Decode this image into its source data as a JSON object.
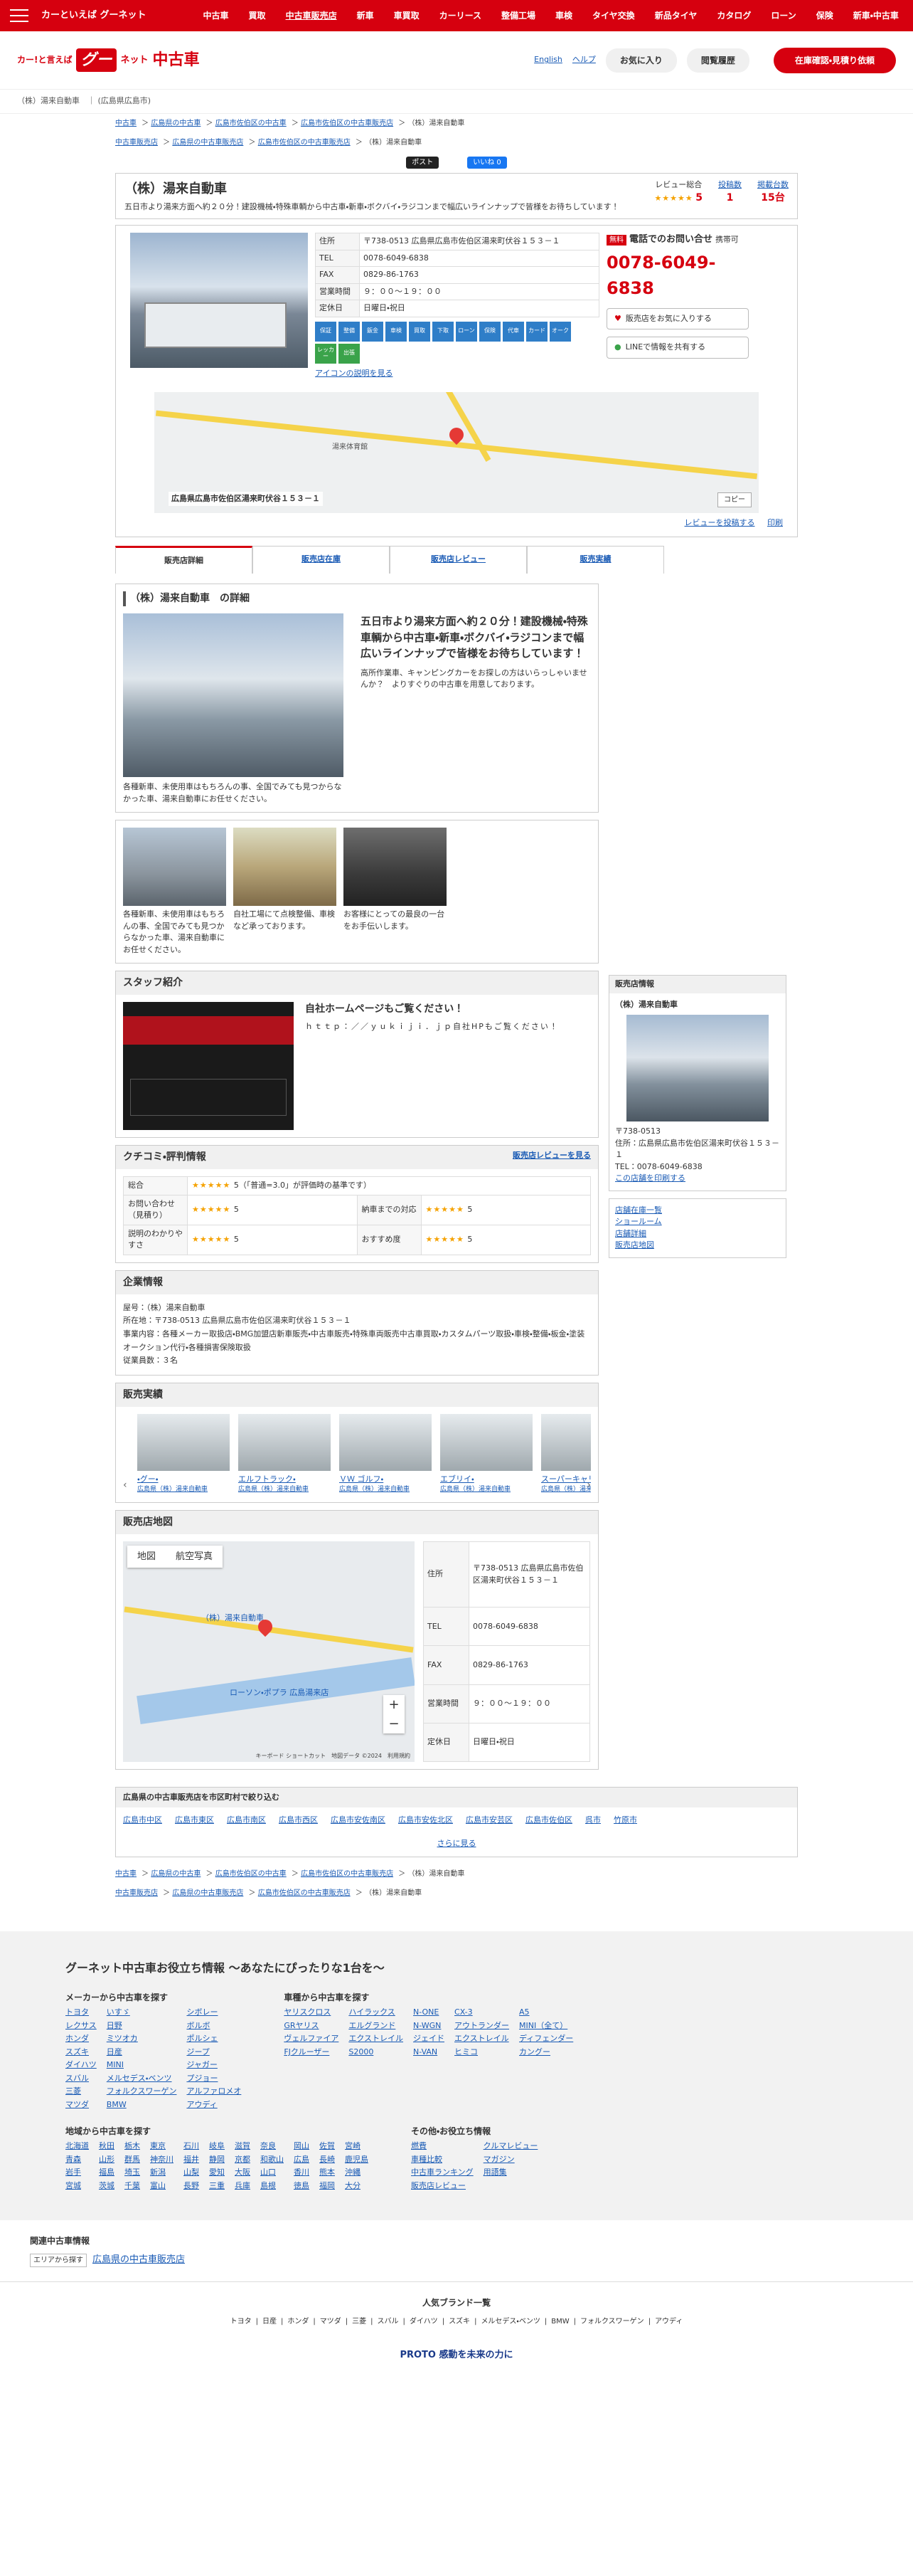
{
  "topbar": {
    "logo": "カーといえば グーネット",
    "nav": [
      "中古車",
      "買取",
      "中古車販売店",
      "新車",
      "車買取",
      "カーリース",
      "整備工場",
      "車検",
      "タイヤ交換",
      "新品タイヤ",
      "カタログ",
      "ローン",
      "保険",
      "新車・中古車"
    ]
  },
  "header": {
    "slogan": "カー!と言えば",
    "goo": "グー",
    "net": "ネット",
    "usedcar": "中古車",
    "english": "English",
    "help": "ヘルプ",
    "fav": "お気に入り",
    "history": "閲覧履歴",
    "cta": "在庫確認・見積り依頼"
  },
  "shopline": "（株）湯来自動車　｜ (広島県広島市)",
  "breadcrumb1": [
    "中古車",
    "広島県の中古車",
    "広島市佐伯区の中古車",
    "広島市佐伯区の中古車販売店",
    "（株）湯来自動車"
  ],
  "breadcrumb2": [
    "中古車販売店",
    "広島県の中古車販売店",
    "広島市佐伯区の中古車販売店",
    "（株）湯来自動車"
  ],
  "share": {
    "x": "ポスト",
    "fb": "いいね 0"
  },
  "shop": {
    "name": "（株）湯来自動車",
    "lead": "五日市より湯来方面へ約２０分！建設機械・特殊車輌から中古車・新車・ボクバイ・ラジコンまで幅広いラインナップで皆様をお待ちしています！",
    "review_label": "レビュー総合",
    "review_score": "5",
    "review_count_label": "投稿数",
    "review_count": "1",
    "stock_label": "掲載台数",
    "stock_count": "15台"
  },
  "info": [
    {
      "k": "住所",
      "v": "〒738-0513 広島県広島市佐伯区湯来町伏谷１５３－１"
    },
    {
      "k": "TEL",
      "v": "0078-6049-6838"
    },
    {
      "k": "FAX",
      "v": "0829-86-1763"
    },
    {
      "k": "営業時間",
      "v": "９：００～１９：００"
    },
    {
      "k": "定休日",
      "v": "日曜日・祝日"
    }
  ],
  "icons": [
    "保証",
    "整備",
    "鈑金",
    "車検",
    "買取",
    "下取",
    "ローン",
    "保険",
    "代車",
    "カード",
    "オーク",
    "レッカー",
    "出張"
  ],
  "icon_link": "アイコンの説明を見る",
  "call": {
    "tag": "無料",
    "label": "電話でのお問い合せ",
    "sub": "携帯可",
    "tel": "0078-6049-6838",
    "fav_btn": "販売店をお気に入りする",
    "line_btn": "LINEで情報を共有する"
  },
  "map_small": {
    "addr": "広島県広島市佐伯区湯来町伏谷１５３－１",
    "copy": "コピー",
    "place": "湯来体育館"
  },
  "map_links": {
    "review": "レビューを投稿する",
    "print": "印刷"
  },
  "tabs": [
    "販売店詳細",
    "販売店在庫",
    "販売店レビュー",
    "販売実績"
  ],
  "detail": {
    "heading": "（株）湯来自動車　の詳細",
    "title": "五日市より湯来方面へ約２０分！建設機械・特殊車輌から中古車・新車・ボクバイ・ラジコンまで幅広いラインナップで皆様をお待ちしています！",
    "text": "高所作業車、キャンピングカーをお探しの方はいらっしゃいませんか？　よりすぐりの中古車を用意しております。",
    "caption": "各種新車、未使用車はもちろんの事、全国でみても見つからなかった車、湯来自動車にお任せください。"
  },
  "gallery": [
    {
      "t": "各種新車、未使用車はもちろんの事、全国でみても見つからなかった車、湯来自動車にお任せください。"
    },
    {
      "t": "自社工場にて点検整備、車検など承っております。"
    },
    {
      "t": "お客様にとっての最良の一台をお手伝いします。"
    }
  ],
  "staff": {
    "heading": "スタッフ紹介",
    "title": "自社ホームページもご覧ください！",
    "url": "ｈｔｔｐ：／／ｙｕｋｉｊｉ．ｊｐ自社HPもご覧ください！"
  },
  "reviews": {
    "heading": "クチコミ・評判情報",
    "link": "販売店レビューを見る",
    "total_label": "総合",
    "total": "5（「普通=3.0」が評価時の基準です）",
    "rows": [
      [
        "お問い合わせ（見積り）",
        "5",
        "納車までの対応",
        "5"
      ],
      [
        "説明のわかりやすさ",
        "5",
        "おすすめ度",
        "5"
      ]
    ]
  },
  "corp": {
    "heading": "企業情報",
    "lines": [
      "屋号：（株）湯来自動車",
      "所在地：〒738-0513 広島県広島市佐伯区湯来町伏谷１５３－１",
      "事業内容：各種メーカー取扱店・BMG加盟店新車販売・中古車販売・特殊車両販売中古車買取・カスタムパーツ取扱・車検・整備・板金・塗装オークション代行・各種損害保険取扱",
      "従業員数：３名"
    ]
  },
  "sales": {
    "heading": "販売実績",
    "cars": [
      {
        "n": "・グー・",
        "s": "広島県（株）湯来自動車"
      },
      {
        "n": "エルフトラック・",
        "s": "広島県（株）湯来自動車"
      },
      {
        "n": "ＶＷ ゴルフ・",
        "s": "広島県（株）湯来自動車"
      },
      {
        "n": "エブリイ・",
        "s": "広島県（株）湯来自動車"
      },
      {
        "n": "スーパーキャリイ・",
        "s": "広島県（株）湯来自動車"
      }
    ]
  },
  "mapsect": {
    "heading": "販売店地図",
    "map": "地図",
    "sat": "航空写真",
    "pinlabel": "（株）湯来自動車",
    "place2": "ローソン・ポプラ 広島湯来店",
    "foot": "キーボード ショートカット　地図データ ©2024　利用規約",
    "info": [
      {
        "k": "住所",
        "v": "〒738-0513 広島県広島市佐伯区湯来町伏谷１５３－１"
      },
      {
        "k": "TEL",
        "v": "0078-6049-6838"
      },
      {
        "k": "FAX",
        "v": "0829-86-1763"
      },
      {
        "k": "営業時間",
        "v": "９：００～１９：００"
      },
      {
        "k": "定休日",
        "v": "日曜日・祝日"
      }
    ]
  },
  "side": {
    "title": "販売店情報",
    "name": "（株）湯来自動車",
    "zip": "〒738-0513",
    "addr": "住所：広島県広島市佐伯区湯来町伏谷１５３－１",
    "tel": "TEL：0078-6049-6838",
    "call_link": "この店舗を印刷する",
    "links": [
      "店舗在庫一覧",
      "ショールーム",
      "店舗詳細",
      "販売店地図"
    ]
  },
  "cities": {
    "heading": "広島県の中古車販売店を市区町村で絞り込む",
    "list": [
      "広島市中区",
      "広島市東区",
      "広島市南区",
      "広島市西区",
      "広島市安佐南区",
      "広島市安佐北区",
      "広島市安芸区",
      "広島市佐伯区",
      "呉市",
      "竹原市"
    ],
    "more": "さらに見る"
  },
  "footer": {
    "title": "グーネット中古車お役立ち情報 〜あなたにぴったりな1台を〜",
    "maker_h": "メーカーから中古車を探す",
    "makers": [
      "トヨタ",
      "レクサス",
      "ホンダ",
      "スズキ",
      "ダイハツ",
      "スバル",
      "三菱",
      "マツダ",
      "いすゞ",
      "日野",
      "ミツオカ",
      "日産",
      "MINI",
      "メルセデス・ベンツ",
      "フォルクスワーゲン",
      "BMW",
      "シボレー",
      "ボルボ",
      "ポルシェ",
      "ジープ",
      "ジャガー",
      "プジョー",
      "アルファロメオ",
      "アウディ"
    ],
    "model_h": "車種から中古車を探す",
    "models": [
      "ヤリスクロス",
      "GRヤリス",
      "ヴェルファイア",
      "FJクルーザー",
      "ハイラックス",
      "エルグランド",
      "エクストレイル",
      "S2000",
      "N-ONE",
      "N-WGN",
      "ジェイド",
      "N-VAN",
      "CX-3",
      "アウトランダー",
      "エクストレイル",
      "ヒミコ",
      "A5",
      "MINI（全て）",
      "ディフェンダー",
      "カングー"
    ],
    "area_h": "地域から中古車を探す",
    "areas": [
      "北海道",
      "青森",
      "岩手",
      "宮城",
      "秋田",
      "山形",
      "福島",
      "茨城",
      "栃木",
      "群馬",
      "埼玉",
      "千葉",
      "東京",
      "神奈川",
      "新潟",
      "富山",
      "石川",
      "福井",
      "山梨",
      "長野",
      "岐阜",
      "静岡",
      "愛知",
      "三重",
      "滋賀",
      "京都",
      "大阪",
      "兵庫",
      "奈良",
      "和歌山",
      "山口",
      "島根",
      "岡山",
      "広島",
      "香川",
      "徳島",
      "佐賀",
      "長崎",
      "熊本",
      "福岡",
      "宮崎",
      "鹿児島",
      "沖縄",
      "大分"
    ],
    "other_h": "その他・お役立ち情報",
    "others": [
      "燃費",
      "車種比較",
      "中古車ランキング",
      "販売店レビュー",
      "クルマレビュー",
      "マガジン",
      "用語集"
    ]
  },
  "related": {
    "heading": "関連中古車情報",
    "tag": "エリアから探す",
    "link": "広島県の中古車販売店"
  },
  "brands": {
    "heading": "人気ブランド一覧",
    "list": [
      "トヨタ",
      "日産",
      "ホンダ",
      "マツダ",
      "三菱",
      "スバル",
      "ダイハツ",
      "スズキ",
      "メルセデス・ベンツ",
      "BMW",
      "フォルクスワーゲン",
      "アウディ"
    ]
  },
  "proto": "PROTO 感動を未来の力に"
}
